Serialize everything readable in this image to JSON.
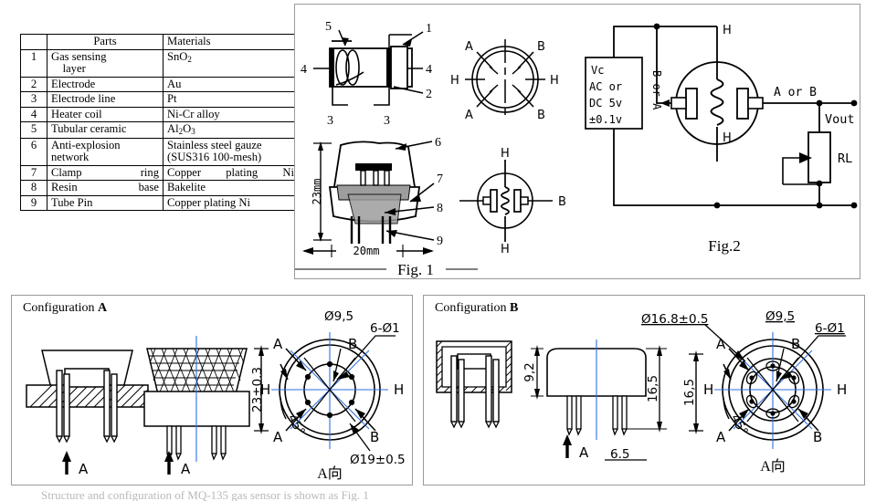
{
  "parts_table": {
    "headers": [
      "",
      "Parts",
      "Materials"
    ],
    "rows": [
      {
        "no": "1",
        "part": "Gas sensing layer",
        "material": "SnO2",
        "material_sub": "2"
      },
      {
        "no": "2",
        "part": "Electrode",
        "material": "Au"
      },
      {
        "no": "3",
        "part": "Electrode line",
        "material": "Pt"
      },
      {
        "no": "4",
        "part": "Heater coil",
        "material": "Ni-Cr alloy"
      },
      {
        "no": "5",
        "part": "Tubular ceramic",
        "material": "Al2O3"
      },
      {
        "no": "6",
        "part": "Anti-explosion network",
        "material": "Stainless steel gauze (SUS316 100-mesh)"
      },
      {
        "no": "7",
        "part": "Clamp   ring",
        "material": "Copper   plating   Ni"
      },
      {
        "no": "8",
        "part": "Resin   base",
        "material": "Bakelite"
      },
      {
        "no": "9",
        "part": "Tube Pin",
        "material": "Copper plating Ni"
      }
    ]
  },
  "fig1": {
    "caption": "Fig. 1",
    "cross_section_labels": {
      "five": "5",
      "one": "1",
      "four_left": "4",
      "four_right": "4",
      "two": "2",
      "three_left": "3",
      "three_right": "3"
    },
    "body_labels": {
      "six": "6",
      "seven": "7",
      "eight": "8",
      "nine": "9",
      "height": "23mm",
      "width": "20mm"
    },
    "pin_circle_top": {
      "a_top": "A",
      "b_top": "B",
      "h_left": "H",
      "h_right": "H",
      "a_bottom": "A",
      "b_bottom": "B"
    },
    "pin_circle_bottom": {
      "h_top": "H",
      "h_bottom": "H",
      "b_right": "B"
    }
  },
  "fig2": {
    "caption": "Fig.2",
    "supply_box": [
      "Vc",
      "AC  or",
      "DC  5v",
      "±0.1v"
    ],
    "vertical_label": "B or A",
    "h_top": "H",
    "h_bottom": "H",
    "output_label": "A or  B",
    "vout": "Vout",
    "load": "RL"
  },
  "config_a": {
    "title_prefix": "Configuration ",
    "title_letter": "A",
    "view_arrow_label": "A",
    "view_arrow_label2": "A",
    "height_dim": "23±0.3",
    "dim_d95": "Ø9,5",
    "dim_6d1": "6-Ø1",
    "dim_d19": "Ø19±0.5",
    "angle": "45°",
    "view_label": "A向",
    "pins": {
      "a1": "A",
      "b1": "B",
      "h_left": "H",
      "h_right": "H",
      "a2": "A",
      "b2": "B"
    }
  },
  "config_b": {
    "title_prefix": "Configuration ",
    "title_letter": "B",
    "view_arrow_label": "A",
    "dim_92": "9,2",
    "dim_165": "16,5",
    "dim_165b": "16,5",
    "dim_65": "6.5",
    "dim_d168": "Ø16.8±0.5",
    "dim_d95": "Ø9,5",
    "dim_6d1": "6-Ø1",
    "angle": "45°",
    "view_label": "A向",
    "pins": {
      "a1": "A",
      "b1": "B",
      "h_left": "H",
      "h_right": "H",
      "a2": "A",
      "b2": "B"
    }
  },
  "bottom_caption": "Structure and configuration of MQ-135 gas sensor is shown as Fig. 1",
  "colors": {
    "border": "#9a9a9a",
    "centerline": "#2f6fe0",
    "shade": "#9d9d9d"
  }
}
